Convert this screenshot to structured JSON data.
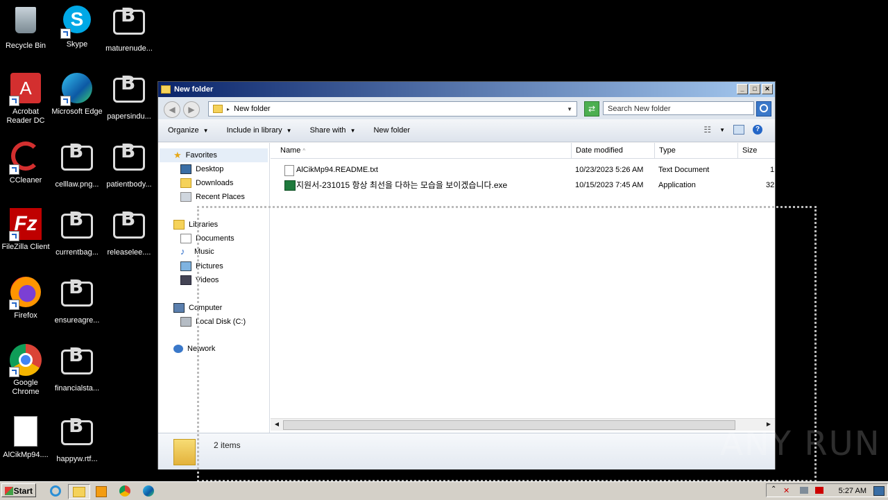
{
  "desktop": {
    "icons": [
      {
        "label": "Recycle Bin"
      },
      {
        "label": "Skype"
      },
      {
        "label": "maturenude..."
      },
      {
        "label": "Acrobat Reader DC"
      },
      {
        "label": "Microsoft Edge"
      },
      {
        "label": "papersindu..."
      },
      {
        "label": "CCleaner"
      },
      {
        "label": "celllaw.png..."
      },
      {
        "label": "patientbody..."
      },
      {
        "label": "FileZilla Client"
      },
      {
        "label": "currentbag..."
      },
      {
        "label": "releaselee...."
      },
      {
        "label": "Firefox"
      },
      {
        "label": "ensureagre..."
      },
      {
        "label": "Google Chrome"
      },
      {
        "label": "financialsta..."
      },
      {
        "label": "AlCikMp94...."
      },
      {
        "label": "happyw.rtf..."
      }
    ]
  },
  "window": {
    "title": "New folder",
    "address": "New folder",
    "search_placeholder": "Search New folder",
    "commands": [
      "Organize",
      "Include in library",
      "Share with",
      "New folder"
    ],
    "nav": {
      "favorites": "Favorites",
      "desktop": "Desktop",
      "downloads": "Downloads",
      "recent": "Recent Places",
      "libraries": "Libraries",
      "documents": "Documents",
      "music": "Music",
      "pictures": "Pictures",
      "videos": "Videos",
      "computer": "Computer",
      "local_disk": "Local Disk (C:)",
      "network": "Network"
    },
    "columns": [
      "Name",
      "Date modified",
      "Type",
      "Size"
    ],
    "files": [
      {
        "name": "AlCikMp94.README.txt",
        "date": "10/23/2023 5:26 AM",
        "type": "Text Document",
        "size": "1"
      },
      {
        "name": "지원서-231015 항상 최선을 다하는 모습을 보이겠습니다.exe",
        "date": "10/15/2023 7:45 AM",
        "type": "Application",
        "size": "32"
      }
    ],
    "status": "2 items"
  },
  "taskbar": {
    "start": "Start",
    "clock": "5:27 AM"
  },
  "watermark": "ANY RUN"
}
